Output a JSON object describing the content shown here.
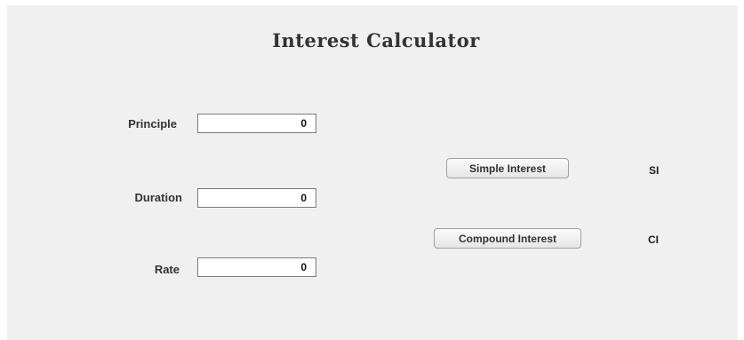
{
  "app": {
    "title": "Interest Calculator"
  },
  "form": {
    "principle_label": "Principle",
    "principle_value": "0",
    "duration_label": "Duration",
    "duration_value": "0",
    "rate_label": "Rate",
    "rate_value": "0"
  },
  "actions": {
    "simple_interest_label": "Simple Interest",
    "compound_interest_label": "Compound Interest"
  },
  "results": {
    "simple_interest_text": "SI",
    "compound_interest_text": "CI"
  }
}
